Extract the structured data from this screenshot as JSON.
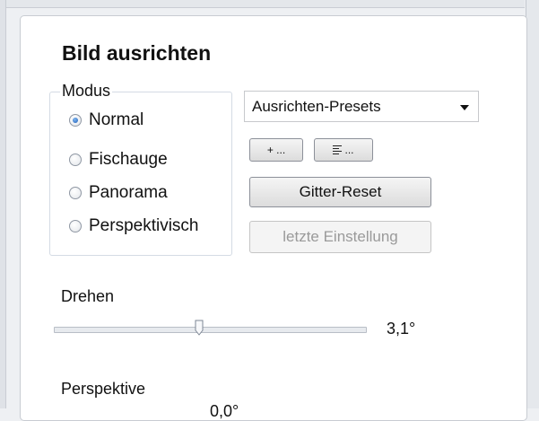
{
  "panel": {
    "title": "Bild ausrichten",
    "modus": {
      "legend": "Modus",
      "options": [
        {
          "label": "Normal",
          "checked": true
        },
        {
          "label": "Fischauge",
          "checked": false
        },
        {
          "label": "Panorama",
          "checked": false
        },
        {
          "label": "Perspektivisch",
          "checked": false
        }
      ]
    },
    "presets": {
      "selected": "Ausrichten-Presets"
    },
    "buttons": {
      "add": "+ ...",
      "manage": "...",
      "grid_reset": "Gitter-Reset",
      "last_setting": "letzte Einstellung"
    },
    "rotate": {
      "label": "Drehen",
      "value_text": "3,1°"
    },
    "perspective": {
      "label": "Perspektive",
      "value_text": "0,0°"
    }
  }
}
